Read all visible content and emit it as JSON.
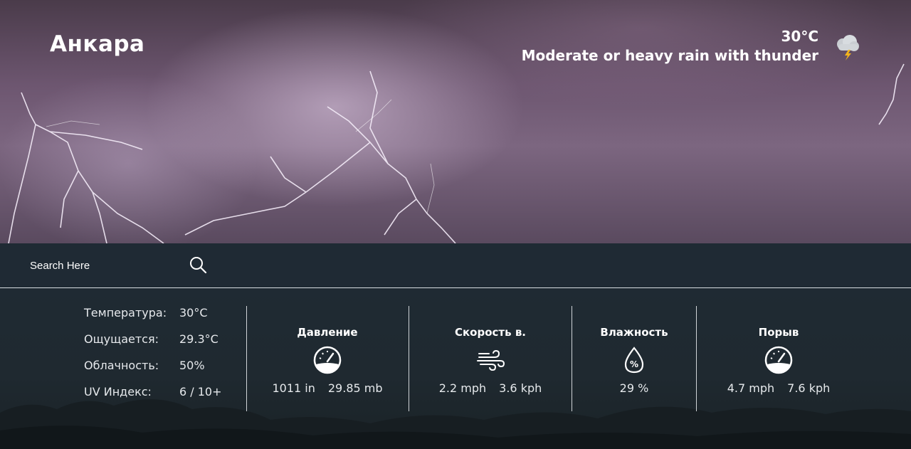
{
  "location": {
    "city": "Анкара"
  },
  "current": {
    "temperature": "30°C",
    "condition": "Moderate or heavy rain with thunder",
    "icon": "thunderstorm-icon"
  },
  "search": {
    "placeholder": "Search Here",
    "icon": "search-icon"
  },
  "stats": [
    {
      "label": "Температура:",
      "value": "30°C"
    },
    {
      "label": "Ощущается:",
      "value": "29.3°C"
    },
    {
      "label": "Облачность:",
      "value": "50%"
    },
    {
      "label": "UV Индекс:",
      "value": "6 / 10+"
    }
  ],
  "cards": {
    "pressure": {
      "title": "Давление",
      "icon": "gauge-icon",
      "value1": "1011 in",
      "value2": "29.85 mb"
    },
    "wind": {
      "title": "Скорость в.",
      "icon": "wind-icon",
      "value1": "2.2 mph",
      "value2": "3.6 kph"
    },
    "humidity": {
      "title": "Влажность",
      "icon": "humidity-drop-icon",
      "value1": "29 %"
    },
    "gust": {
      "title": "Порыв",
      "icon": "gauge-icon",
      "value1": "4.7 mph",
      "value2": "7.6 kph"
    }
  },
  "colors": {
    "panel_bg": "#1f2a33",
    "text": "#ffffff",
    "divider": "#d0d4d8"
  }
}
